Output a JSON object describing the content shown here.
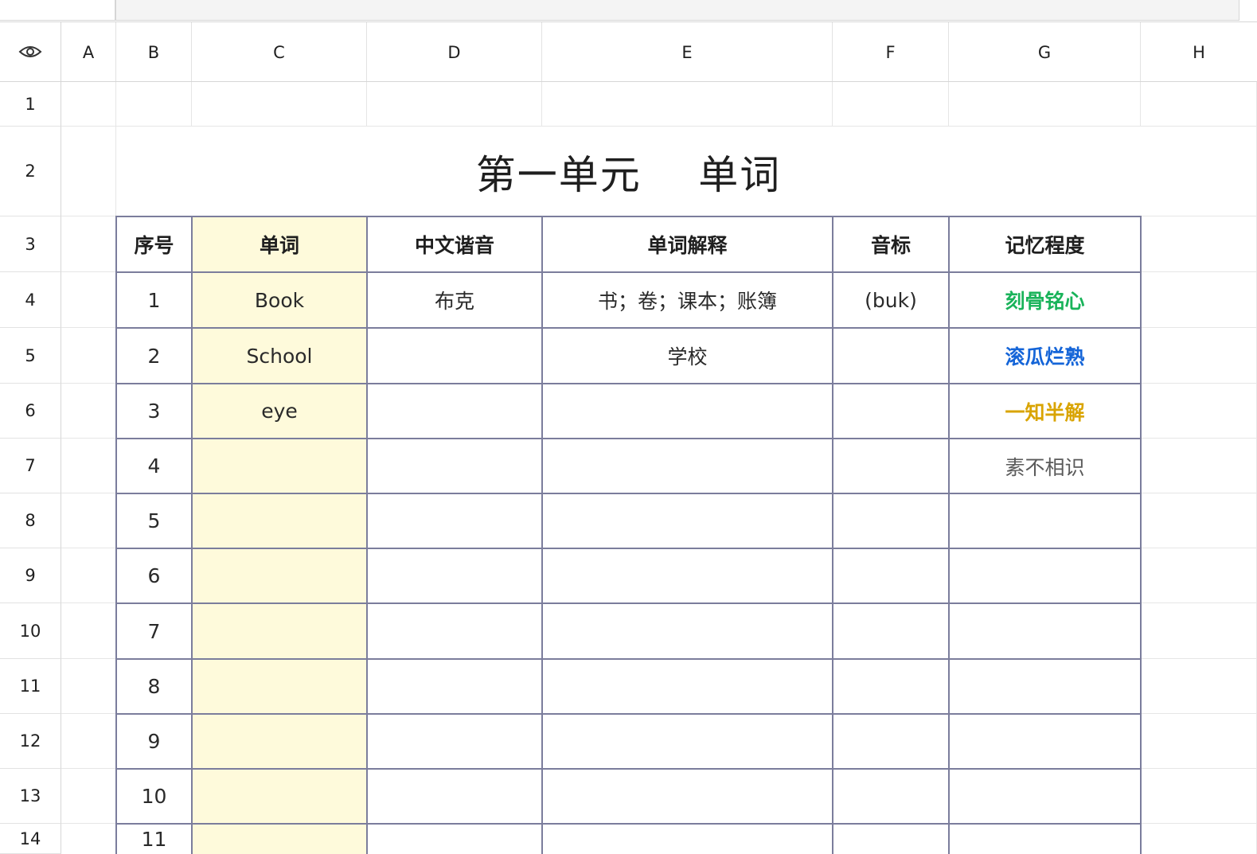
{
  "columns": [
    "A",
    "B",
    "C",
    "D",
    "E",
    "F",
    "G",
    "H"
  ],
  "rows": [
    "1",
    "2",
    "3",
    "4",
    "5",
    "6",
    "7",
    "8",
    "9",
    "10",
    "11",
    "12",
    "13",
    "14"
  ],
  "title": "第一单元    单词",
  "table": {
    "headers": [
      "序号",
      "单词",
      "中文谐音",
      "单词解释",
      "音标",
      "记忆程度"
    ],
    "rows": [
      [
        "1",
        "Book",
        "布克",
        "书；卷；课本；账簿",
        "(buk)",
        "刻骨铭心"
      ],
      [
        "2",
        "School",
        "",
        "学校",
        "",
        "滚瓜烂熟"
      ],
      [
        "3",
        "eye",
        "",
        "",
        "",
        "一知半解"
      ],
      [
        "4",
        "",
        "",
        "",
        "",
        "素不相识"
      ],
      [
        "5",
        "",
        "",
        "",
        "",
        ""
      ],
      [
        "6",
        "",
        "",
        "",
        "",
        ""
      ],
      [
        "7",
        "",
        "",
        "",
        "",
        ""
      ],
      [
        "8",
        "",
        "",
        "",
        "",
        ""
      ],
      [
        "9",
        "",
        "",
        "",
        "",
        ""
      ],
      [
        "10",
        "",
        "",
        "",
        "",
        ""
      ],
      [
        "11",
        "",
        "",
        "",
        "",
        ""
      ]
    ]
  },
  "memory_colors": {
    "刻骨铭心": "#19b35a",
    "滚瓜烂熟": "#1565d8",
    "一知半解": "#d9a400",
    "素不相识": "#5a5a5a"
  },
  "icons": {
    "corner": "eye-icon"
  }
}
